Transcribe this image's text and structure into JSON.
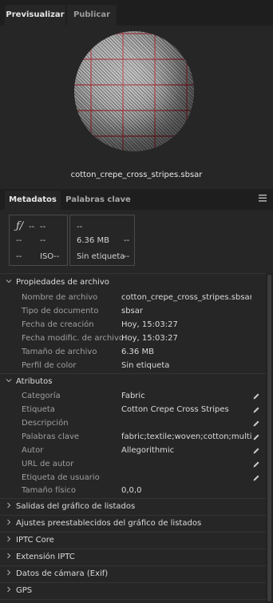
{
  "top_tabs": {
    "preview": "Previsualizar",
    "publish": "Publicar"
  },
  "preview": {
    "filename": "cotton_crepe_cross_stripes.sbsar"
  },
  "panel_tabs": {
    "metadata": "Metadatos",
    "keywords": "Palabras clave"
  },
  "camera_card": {
    "f_symbol": "ƒ/",
    "f_value": "--",
    "shutter": "--",
    "r2c1": "--",
    "r2c2": "--",
    "r3c1": "--",
    "iso_label": "ISO",
    "iso_value": "--"
  },
  "file_card": {
    "r1": "--",
    "size": "6.36 MB",
    "r2c2": "--",
    "label": "Sin etiqueta",
    "r3c2": "--"
  },
  "file_props": {
    "title": "Propiedades de archivo",
    "fields": [
      {
        "key": "Nombre de archivo",
        "value": "cotton_crepe_cross_stripes.sbsar"
      },
      {
        "key": "Tipo de documento",
        "value": "sbsar"
      },
      {
        "key": "Fecha de creación",
        "value": "Hoy, 15:03:27"
      },
      {
        "key": "Fecha modific. de archivo",
        "value": "Hoy, 15:03:27"
      },
      {
        "key": "Tamaño de archivo",
        "value": "6.36 MB"
      },
      {
        "key": "Perfil de color",
        "value": "Sin etiqueta"
      }
    ]
  },
  "attributes": {
    "title": "Atributos",
    "fields": [
      {
        "key": "Categoría",
        "value": "Fabric"
      },
      {
        "key": "Etiqueta",
        "value": "Cotton Crepe Cross Stripes"
      },
      {
        "key": "Descripción",
        "value": ""
      },
      {
        "key": "Palabras clave",
        "value": "fabric;textile;woven;cotton;multicolor"
      },
      {
        "key": "Autor",
        "value": "Allegorithmic"
      },
      {
        "key": "URL de autor",
        "value": ""
      },
      {
        "key": "Etiqueta de usuario",
        "value": ""
      },
      {
        "key": "Tamaño físico",
        "value": "0,0,0"
      }
    ]
  },
  "collapsed_sections": [
    "Salidas del gráfico de listados",
    "Ajustes preestablecidos del gráfico de listados",
    "IPTC Core",
    "Extensión IPTC",
    "Datos de cámara (Exif)",
    "GPS"
  ],
  "colors": {
    "bg": "#262626",
    "tabbar": "#1e1e1e",
    "text": "#dadada",
    "label": "#9f9f9f"
  }
}
